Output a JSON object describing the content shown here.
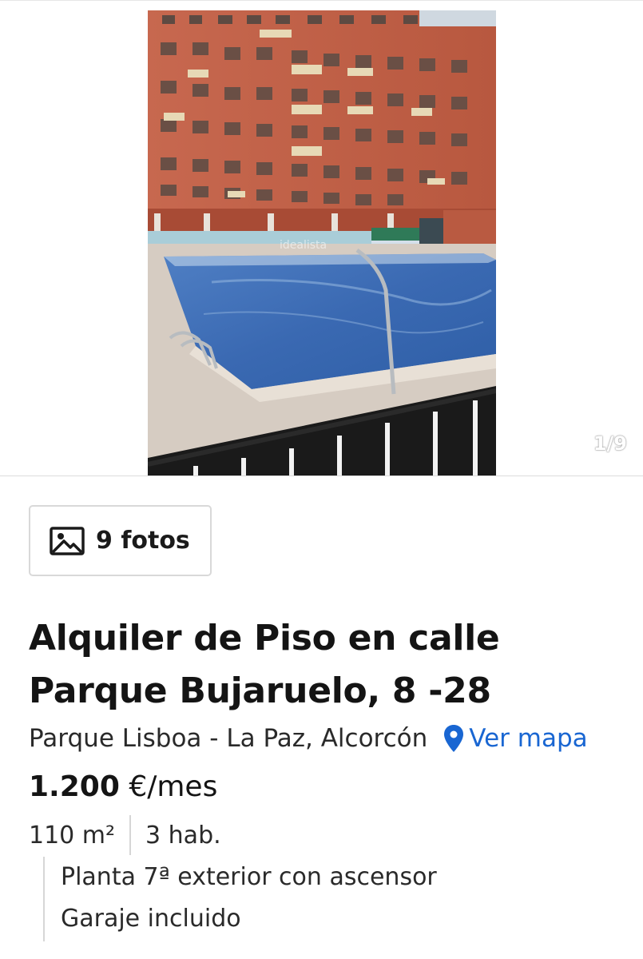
{
  "gallery": {
    "counter": "1/9",
    "watermark": "idealista"
  },
  "photos_button": {
    "icon": "image-icon",
    "label": "9 fotos"
  },
  "listing": {
    "title": "Alquiler de Piso en calle Parque Bujaruelo, 8 -28",
    "location": "Parque Lisboa - La Paz, Alcorcón",
    "map_link": "Ver mapa",
    "map_icon": "location-pin-icon",
    "price_amount": "1.200",
    "price_unit": "€/mes",
    "area": "110 m²",
    "rooms": "3 hab.",
    "features": [
      "Planta 7ª exterior con ascensor",
      "Garaje incluido"
    ]
  },
  "colors": {
    "link": "#1966d2",
    "text": "#1a1a1a",
    "border": "#d9d9d9"
  }
}
